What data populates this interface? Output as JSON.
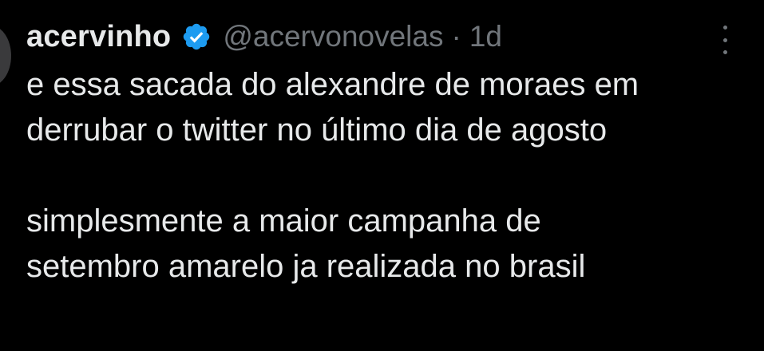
{
  "tweet": {
    "author": {
      "display_name": "acervinho",
      "handle": "@acervonovelas",
      "verified": true,
      "verified_icon": "verified-badge-icon"
    },
    "separator": "·",
    "time": "1d",
    "more_icon": "more-options-icon",
    "text": {
      "paragraph1_line1": "e essa sacada do alexandre de moraes em",
      "paragraph1_line2": "derrubar o twitter no último dia de agosto",
      "paragraph2_line1": "simplesmente a maior campanha de",
      "paragraph2_line2": "setembro amarelo ja realizada no brasil"
    }
  },
  "colors": {
    "background": "#000000",
    "text_primary": "#e7e9ea",
    "text_secondary": "#71767b",
    "verified_badge": "#1d9bf0"
  }
}
